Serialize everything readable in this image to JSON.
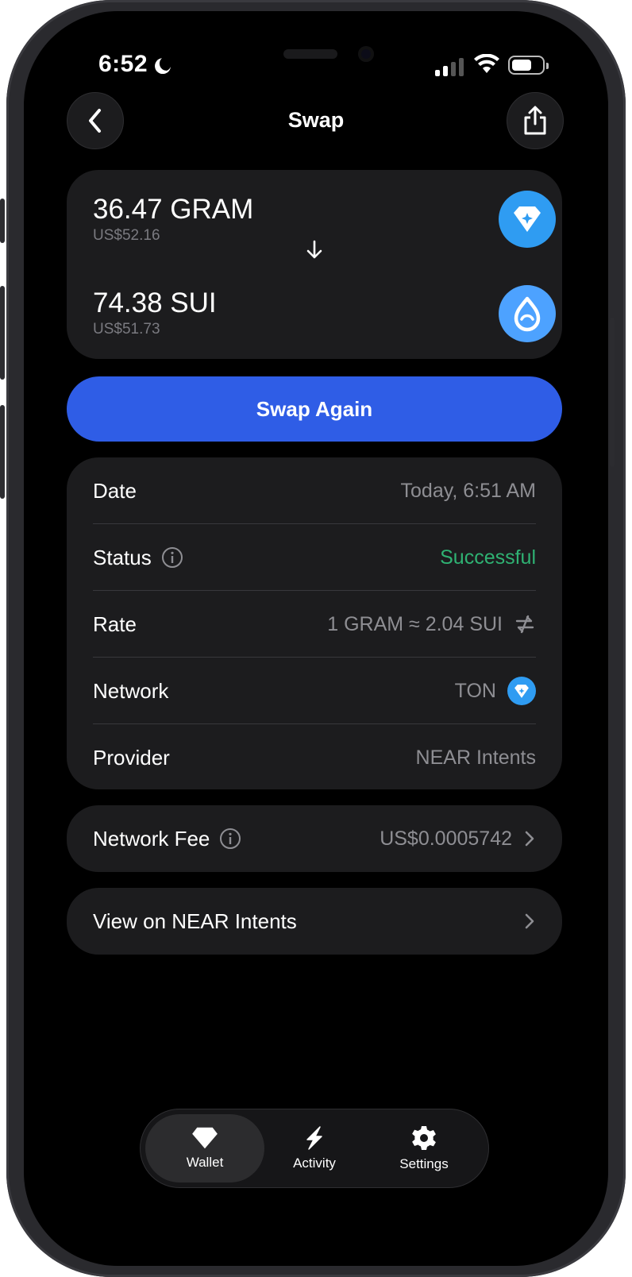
{
  "status_bar": {
    "time": "6:52"
  },
  "header": {
    "title": "Swap"
  },
  "swap": {
    "from": {
      "amount": "36.47 GRAM",
      "usd": "US$52.16",
      "icon": "ton-diamond-icon",
      "color": "#2f9cf2"
    },
    "to": {
      "amount": "74.38 SUI",
      "usd": "US$51.73",
      "icon": "sui-drop-icon",
      "color": "#4da2ff"
    }
  },
  "swap_again_label": "Swap Again",
  "details": {
    "date": {
      "label": "Date",
      "value": "Today, 6:51 AM"
    },
    "status": {
      "label": "Status",
      "value": "Successful",
      "color": "#2fb273"
    },
    "rate": {
      "label": "Rate",
      "value": "1 GRAM ≈ 2.04 SUI"
    },
    "network": {
      "label": "Network",
      "value": "TON"
    },
    "provider": {
      "label": "Provider",
      "value": "NEAR Intents"
    }
  },
  "network_fee": {
    "label": "Network Fee",
    "value": "US$0.0005742"
  },
  "view_link": {
    "label": "View on NEAR Intents"
  },
  "tabs": [
    {
      "label": "Wallet",
      "icon": "wallet-diamond-icon",
      "active": true
    },
    {
      "label": "Activity",
      "icon": "lightning-icon",
      "active": false
    },
    {
      "label": "Settings",
      "icon": "gear-icon",
      "active": false
    }
  ],
  "colors": {
    "accent": "#2f5de6",
    "card": "#1c1c1e",
    "background": "#000000"
  }
}
